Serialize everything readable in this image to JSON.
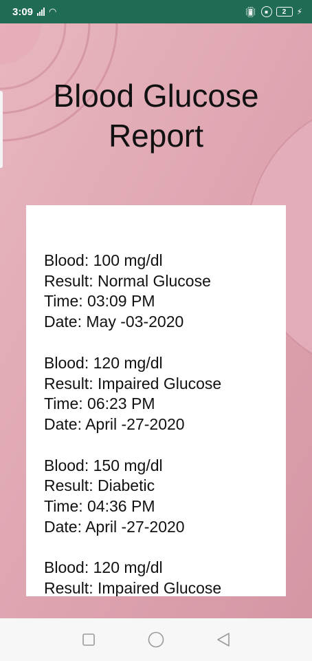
{
  "status_bar": {
    "time": "3:09",
    "battery": "2",
    "icons": [
      "signal-icon",
      "wifi-icon",
      "vibrate-icon",
      "lock-rotation-icon",
      "battery-icon",
      "charging-icon"
    ]
  },
  "page": {
    "title": "Blood Glucose\nReport"
  },
  "records": [
    {
      "blood": "Blood: 100 mg/dl",
      "result": "Result: Normal Glucose",
      "time": "Time: 03:09 PM",
      "date": "Date: May -03-2020"
    },
    {
      "blood": "Blood: 120 mg/dl",
      "result": "Result: Impaired Glucose",
      "time": "Time: 06:23 PM",
      "date": "Date: April -27-2020"
    },
    {
      "blood": "Blood: 150 mg/dl",
      "result": "Result: Diabetic",
      "time": "Time: 04:36 PM",
      "date": "Date: April -27-2020"
    },
    {
      "blood": "Blood: 120 mg/dl",
      "result": "Result: Impaired Glucose",
      "time": "",
      "date": ""
    }
  ],
  "nav": {
    "icons": [
      "recents-icon",
      "home-icon",
      "back-icon"
    ]
  },
  "colors": {
    "status_bar": "#1f6b55",
    "background": "#d9a0ac",
    "card": "#ffffff"
  }
}
